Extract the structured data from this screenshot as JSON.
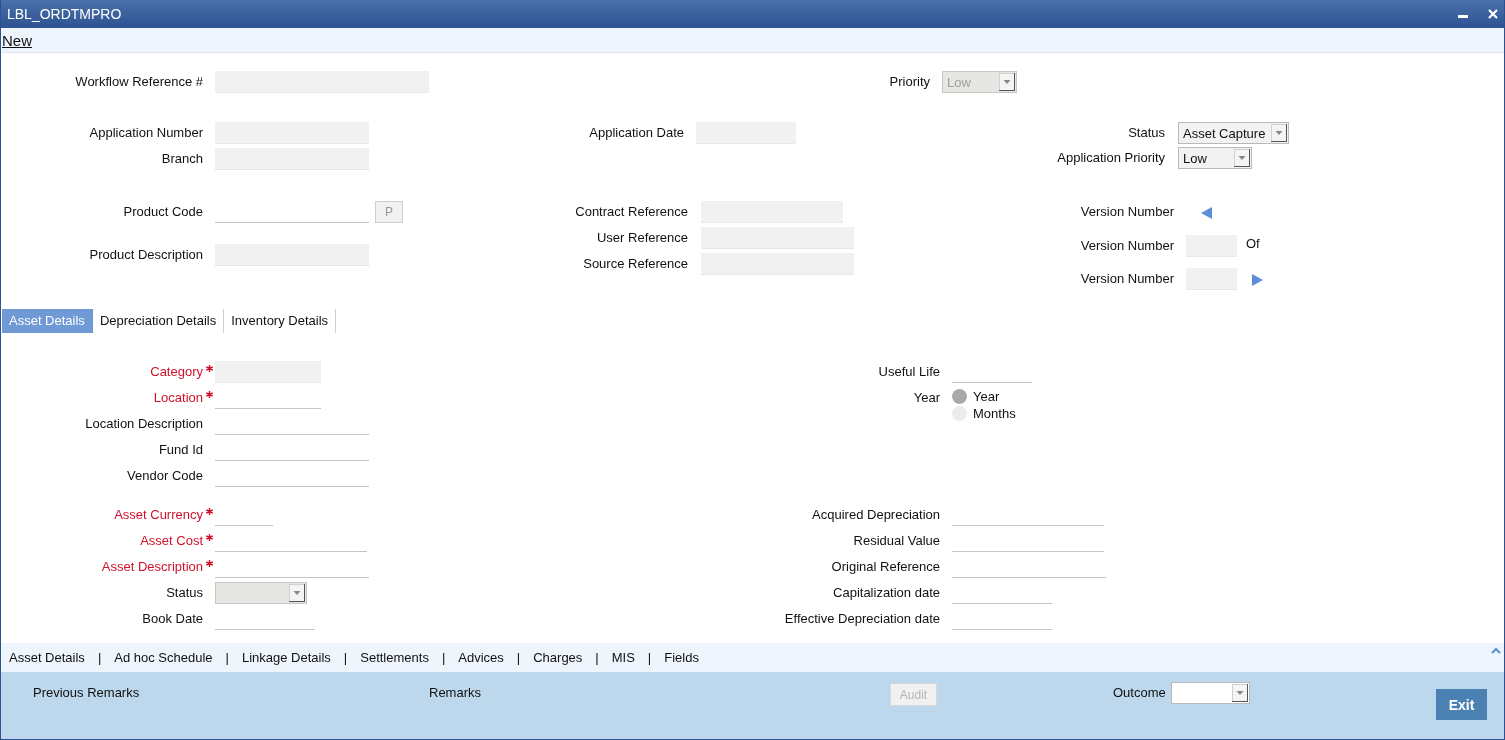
{
  "window": {
    "title": "LBL_ORDTMPRO"
  },
  "toolbar": {
    "link": "New"
  },
  "header": {
    "groups": [
      [
        {
          "label": "Workflow Reference #",
          "kind": "text",
          "readonly": true
        }
      ],
      [
        {
          "label": "Priority",
          "kind": "select",
          "value": "Low",
          "disabled": true
        }
      ],
      [
        {
          "label": "Application Number",
          "kind": "text",
          "readonly": true
        },
        {
          "label": "Branch",
          "kind": "text",
          "readonly": true
        }
      ],
      [
        {
          "label": "Application Date",
          "kind": "text",
          "readonly": true
        }
      ],
      [
        {
          "label": "Status",
          "kind": "select",
          "value": "Asset Capture",
          "disabled": false
        },
        {
          "label": "Application Priority",
          "kind": "select",
          "value": "Low",
          "disabled": false
        }
      ],
      [
        {
          "label": "Product Code",
          "kind": "lookup",
          "readonly": false,
          "button": "P"
        },
        {
          "label": "Product Description",
          "kind": "text",
          "readonly": true
        }
      ],
      [
        {
          "label": "Contract Reference",
          "kind": "text",
          "readonly": true
        },
        {
          "label": "User Reference",
          "kind": "text",
          "readonly": true
        },
        {
          "label": "Source Reference",
          "kind": "text",
          "readonly": true
        }
      ],
      [
        {
          "label": "Version Number",
          "kind": "previous"
        },
        {
          "label": "Version Number",
          "kind": "text",
          "readonly": true,
          "suffix": "Of"
        },
        {
          "label": "Version Number",
          "kind": "next",
          "readonly": true
        }
      ]
    ]
  },
  "tabs": [
    {
      "label": "Asset Details",
      "selected": true
    },
    {
      "label": "Depreciation Details",
      "selected": false
    },
    {
      "label": "Inventory Details",
      "selected": false
    }
  ],
  "asset_details": {
    "left": [
      {
        "label": "Category",
        "kind": "text",
        "required": true,
        "readonly": true
      },
      {
        "label": "Location",
        "kind": "text",
        "required": true,
        "readonly": false
      },
      {
        "label": "Location Description",
        "kind": "text",
        "required": false,
        "readonly": false
      },
      {
        "label": "Fund Id",
        "kind": "text",
        "required": false,
        "readonly": false
      },
      {
        "label": "Vendor Code",
        "kind": "text",
        "required": false,
        "readonly": false
      },
      {
        "label": "Asset Currency",
        "kind": "text",
        "required": true,
        "readonly": false
      },
      {
        "label": "Asset Cost",
        "kind": "text",
        "required": true,
        "readonly": false
      },
      {
        "label": "Asset Description",
        "kind": "text",
        "required": true,
        "readonly": false
      },
      {
        "label": "Status",
        "kind": "select",
        "required": false,
        "disabled": true
      },
      {
        "label": "Book Date",
        "kind": "text",
        "required": false,
        "readonly": false
      }
    ],
    "right": [
      {
        "label": "Useful Life",
        "kind": "text",
        "readonly": false
      },
      {
        "label": "Year",
        "kind": "radio",
        "options": [
          {
            "label": "Year",
            "selected": true
          },
          {
            "label": "Months",
            "selected": false
          }
        ]
      },
      {
        "label": "Acquired Depreciation",
        "kind": "text",
        "readonly": false
      },
      {
        "label": "Residual Value",
        "kind": "text",
        "readonly": false
      },
      {
        "label": "Original Reference",
        "kind": "text",
        "readonly": false
      },
      {
        "label": "Capitalization date",
        "kind": "text",
        "readonly": false
      },
      {
        "label": "Effective Depreciation date",
        "kind": "text",
        "readonly": false
      }
    ]
  },
  "footer_links": {
    "separator": "|",
    "items": [
      "Asset Details",
      "Ad hoc Schedule",
      "Linkage Details",
      "Settlements",
      "Advices",
      "Charges",
      "MIS",
      "Fields"
    ]
  },
  "bottom_panel": {
    "previous_remarks": "Previous Remarks",
    "remarks": "Remarks",
    "audit": {
      "label": "Audit",
      "disabled": true
    },
    "outcome": {
      "label": "Outcome",
      "disabled": false
    },
    "exit": "Exit"
  }
}
